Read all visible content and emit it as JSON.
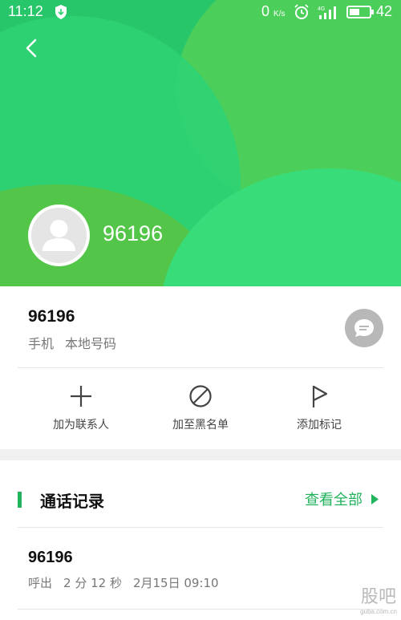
{
  "status_bar": {
    "time": "11:12",
    "net_speed": "0",
    "net_unit": "K/s",
    "network_type": "4G",
    "battery": "42",
    "icons": [
      "shield-icon",
      "alarm-icon",
      "signal-icon",
      "battery-icon"
    ]
  },
  "header": {
    "number": "96196",
    "back_icon": "chevron-left-icon",
    "avatar_icon": "person-icon"
  },
  "info": {
    "number": "96196",
    "type": "手机",
    "location": "本地号码",
    "message_icon": "message-icon"
  },
  "actions": [
    {
      "label": "加为联系人",
      "icon": "plus-icon"
    },
    {
      "label": "加至黑名单",
      "icon": "block-icon"
    },
    {
      "label": "添加标记",
      "icon": "flag-icon"
    }
  ],
  "call_log": {
    "title": "通话记录",
    "view_all": "查看全部",
    "entries": [
      {
        "number": "96196",
        "direction": "呼出",
        "duration": "2 分 12 秒",
        "date": "2月15日 09:10"
      }
    ]
  },
  "watermark": {
    "text": "股吧",
    "url": "guba.com.cn"
  },
  "colors": {
    "accent": "#22b35d",
    "header_green": "#28c66a",
    "muted_text": "#777777"
  }
}
